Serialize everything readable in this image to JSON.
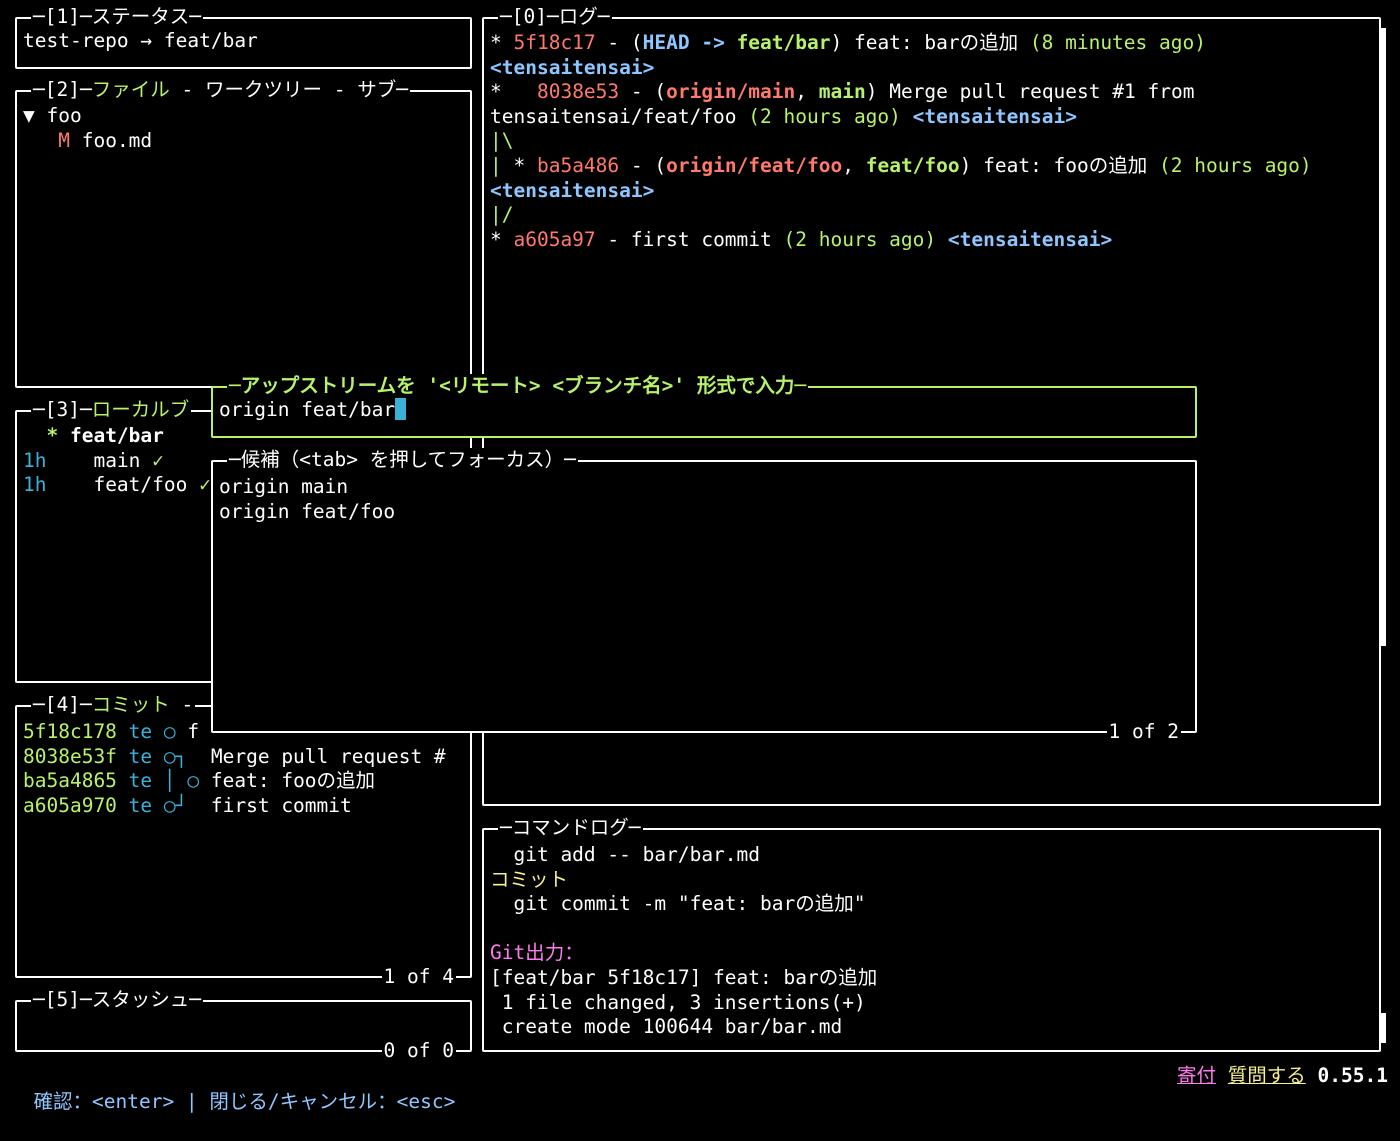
{
  "panels": {
    "status": {
      "title_num": "[1]",
      "title": "ステータス",
      "line": "test-repo → feat/bar"
    },
    "files": {
      "title_num": "[2]",
      "title": "ファイル",
      "title_rest": " - ワークツリー - サブ",
      "tree": [
        {
          "prefix": "▼ ",
          "name": "foo"
        },
        {
          "prefix": "   ",
          "status": "M",
          "name": " foo.md"
        }
      ]
    },
    "branches": {
      "title_num": "[3]",
      "title": "ローカルブ",
      "rows": [
        {
          "age": "",
          "marker": "  * ",
          "name": "feat/bar",
          "check": ""
        },
        {
          "age": "1h",
          "marker": "  ",
          "name": "main",
          "check": "✓"
        },
        {
          "age": "1h",
          "marker": "  ",
          "name": "feat/foo",
          "check": "✓"
        }
      ]
    },
    "commits": {
      "title_num": "[4]",
      "title": "コミット",
      "title_rest": " -",
      "footer": "1 of 4",
      "rows": [
        {
          "sha": "5f18c178",
          "author": "te",
          "graph": "○",
          "msg": "f"
        },
        {
          "sha": "8038e53f",
          "author": "te",
          "graph": "○┐",
          "msg": "Merge pull request #"
        },
        {
          "sha": "ba5a4865",
          "author": "te",
          "graph": "│ ○",
          "msg": "feat: fooの追加"
        },
        {
          "sha": "a605a970",
          "author": "te",
          "graph": "○┘",
          "msg": "first commit"
        }
      ]
    },
    "stash": {
      "title_num": "[5]",
      "title": "スタッシュ",
      "footer": "0 of 0"
    },
    "log": {
      "title_num": "[0]",
      "title": "ログ",
      "l1_star": "* ",
      "l1_sha": "5f18c17",
      "l1_dash": " - (",
      "l1_head": "HEAD -> ",
      "l1_branch": "feat/bar",
      "l1_close": ") feat: barの追加 ",
      "l1_age": "(8 minutes ago)",
      "l2_author": "<tensaitensai>",
      "l3_star": "*   ",
      "l3_sha": "8038e53",
      "l3_dash": " - (",
      "l3_ref1": "origin/main",
      "l3_comma": ", ",
      "l3_ref2": "main",
      "l3_msg": ") Merge pull request #1 from",
      "l4_msg": "tensaitensai/feat/foo ",
      "l4_age": "(2 hours ago)",
      "l4_author": " <tensaitensai>",
      "l5_graph": "|\\",
      "l6_graph": "| ",
      "l6_star": "* ",
      "l6_sha": "ba5a486",
      "l6_dash": " - (",
      "l6_ref1": "origin/feat/foo",
      "l6_comma": ", ",
      "l6_ref2": "feat/foo",
      "l6_msg": ") feat: fooの追加 ",
      "l6_age": "(2 hours ago)",
      "l7_author": "<tensaitensai>",
      "l8_graph": "|/",
      "l9_star": "* ",
      "l9_sha": "a605a97",
      "l9_msg": " - first commit ",
      "l9_age": "(2 hours ago)",
      "l9_author": " <tensaitensai>"
    },
    "cmdlog": {
      "title": "コマンドログ",
      "lines": [
        {
          "cls": "",
          "text": "  git add -- bar/bar.md"
        },
        {
          "cls": "c-yellow",
          "text": "コミット"
        },
        {
          "cls": "",
          "text": "  git commit -m \"feat: barの追加\""
        },
        {
          "cls": "",
          "text": ""
        },
        {
          "cls": "c-magenta",
          "text": "Git出力："
        },
        {
          "cls": "",
          "text": "[feat/bar 5f18c17] feat: barの追加"
        },
        {
          "cls": "",
          "text": " 1 file changed, 3 insertions(+)"
        },
        {
          "cls": "",
          "text": " create mode 100644 bar/bar.md"
        }
      ]
    }
  },
  "prompt": {
    "title": "アップストリームを '<リモート> <ブランチ名>' 形式で入力",
    "value": "origin feat/bar"
  },
  "suggestions": {
    "title": "候補（<tab> を押してフォーカス）",
    "items": [
      "origin main",
      "origin feat/foo"
    ],
    "footer": "1 of 2"
  },
  "statusbar": {
    "confirm_label": "確認：",
    "confirm_key": "<enter>",
    "sep": " | ",
    "close_label": "閉じる/キャンセル：",
    "close_key": "<esc>",
    "donate": "寄付",
    "ask": "質問する",
    "version": "0.55.1"
  },
  "colors": {
    "green": "#b6f26a",
    "red": "#ff7a6b",
    "blue": "#8ec6ff",
    "cyan": "#3cb1d8",
    "yellow": "#f6f08d",
    "magenta": "#ff7af0"
  }
}
